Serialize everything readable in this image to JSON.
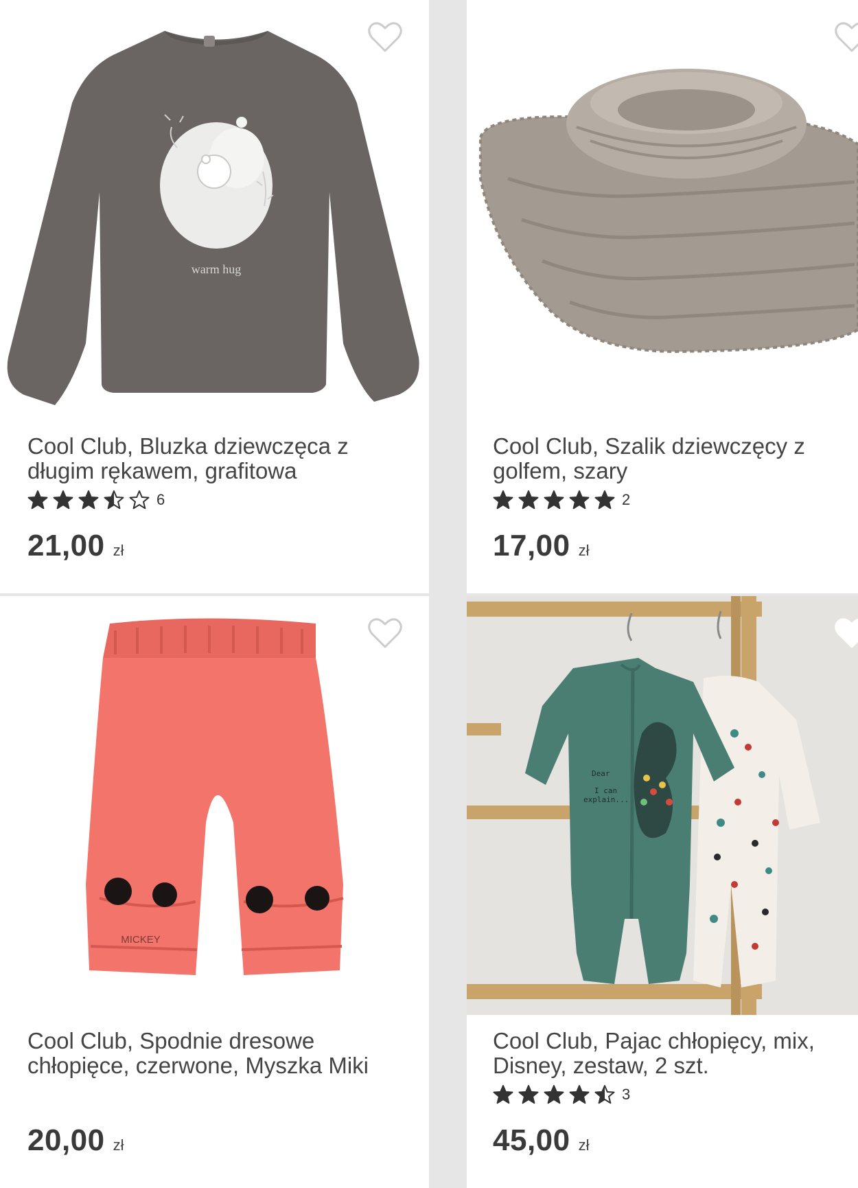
{
  "products": [
    {
      "title_line1": "Cool Club, Bluzka dziewczęca z",
      "title_line2": "długim rękawem, grafitowa",
      "rating": 3.5,
      "reviews": "6",
      "price": "21,00",
      "currency": "zł",
      "image_icon": "sweater-image",
      "image_text": "warm hug"
    },
    {
      "title_line1": "Cool Club, Szalik dziewczęcy z",
      "title_line2": "golfem, szary",
      "rating": 5,
      "reviews": "2",
      "price": "17,00",
      "currency": "zł",
      "image_icon": "knit-scarf-image"
    },
    {
      "title_line1": "Cool Club, Spodnie dresowe",
      "title_line2": "chłopięce, czerwone, Myszka Miki",
      "rating": null,
      "reviews": "",
      "price": "20,00",
      "currency": "zł",
      "image_icon": "pants-image",
      "image_text": "MICKEY"
    },
    {
      "title_line1": "Cool Club, Pajac chłopięcy, mix,",
      "title_line2": "Disney, zestaw, 2 szt.",
      "rating": 4.5,
      "reviews": "3",
      "price": "45,00",
      "currency": "zł",
      "image_icon": "rompers-image",
      "image_text_lines": [
        "Dear",
        "I can",
        "explain..."
      ]
    }
  ],
  "colors": {
    "star": "#333333",
    "price": "#3a3a3a",
    "background": "#e6e6e6",
    "card": "#ffffff",
    "heart": "#cccccc"
  }
}
